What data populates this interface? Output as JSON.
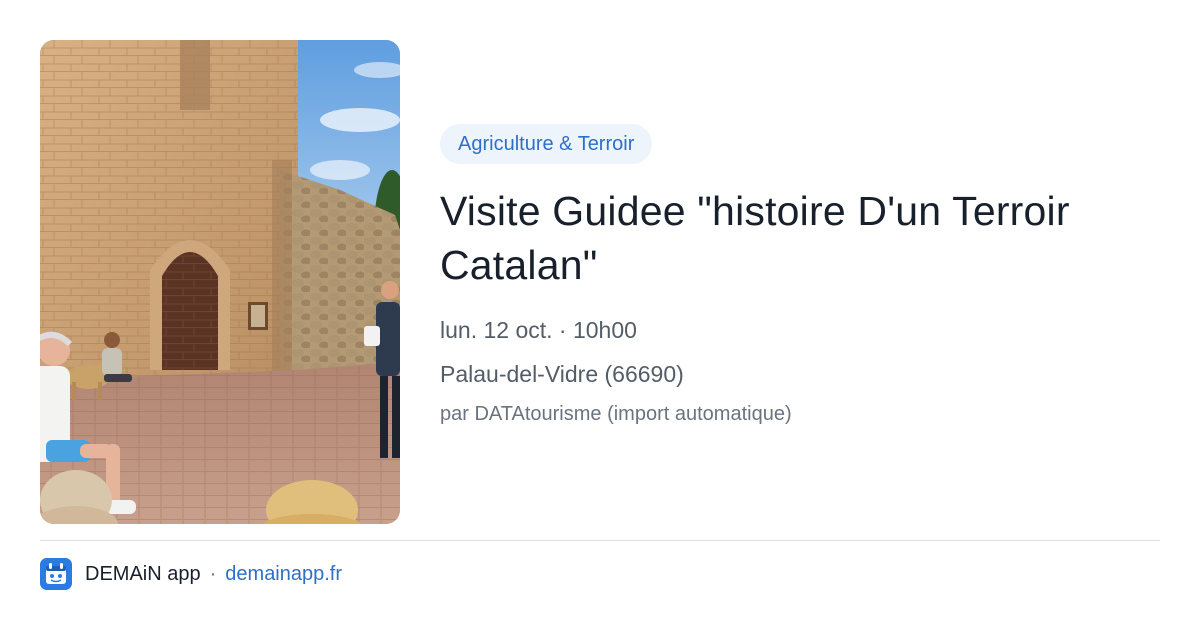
{
  "photo": {
    "alt_icon": "event-photo"
  },
  "event": {
    "category": "Agriculture & Terroir",
    "title": "Visite Guidee \"histoire D'un Terroir Catalan\"",
    "datetime": "lun. 12 oct. · 10h00",
    "location": "Palau-del-Vidre (66690)",
    "source": "par DATAtourisme (import automatique)"
  },
  "footer": {
    "app_name": "DEMAiN app",
    "separator": "·",
    "url": "demainapp.fr"
  },
  "colors": {
    "accent": "#2f6fc8",
    "tag_bg": "#edf4fc",
    "title": "#18202c",
    "muted": "#545c68",
    "divider": "#dbe1e7"
  }
}
